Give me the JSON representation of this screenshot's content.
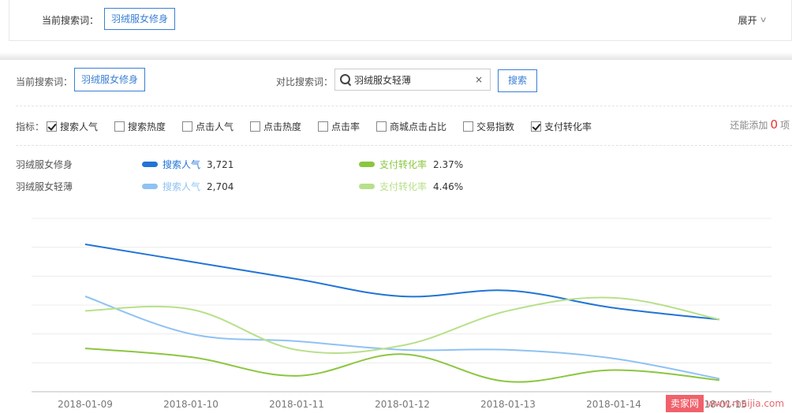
{
  "top": {
    "label": "当前搜索词：",
    "keyword": "羽绒服女修身",
    "expand": "展开"
  },
  "compare": {
    "label": "当前搜索词：",
    "keyword": "羽绒服女修身",
    "compare_label": "对比搜索词：",
    "compare_value": "羽绒服女轻薄",
    "clear": "×",
    "search_btn": "搜索"
  },
  "metrics": {
    "label": "指标：",
    "items": [
      {
        "label": "搜索人气",
        "checked": true
      },
      {
        "label": "搜索热度",
        "checked": false
      },
      {
        "label": "点击人气",
        "checked": false
      },
      {
        "label": "点击热度",
        "checked": false
      },
      {
        "label": "点击率",
        "checked": false
      },
      {
        "label": "商城点击占比",
        "checked": false
      },
      {
        "label": "交易指数",
        "checked": false
      },
      {
        "label": "支付转化率",
        "checked": true
      }
    ],
    "add_prefix": "还能添加",
    "add_count": "0",
    "add_suffix": "项"
  },
  "legend": [
    {
      "keyword": "羽绒服女修身",
      "a": {
        "name": "搜索人气",
        "value": "3,721",
        "color": "#2274d6"
      },
      "b": {
        "name": "支付转化率",
        "value": "2.37%",
        "color": "#8cc63f"
      }
    },
    {
      "keyword": "羽绒服女轻薄",
      "a": {
        "name": "搜索人气",
        "value": "2,704",
        "color": "#8fc2f2"
      },
      "b": {
        "name": "支付转化率",
        "value": "4.46%",
        "color": "#b8e08a"
      }
    }
  ],
  "chart_data": {
    "type": "line",
    "x": [
      "2018-01-09",
      "2018-01-10",
      "2018-01-11",
      "2018-01-12",
      "2018-01-13",
      "2018-01-14",
      "2018-01-15"
    ],
    "ylim": [
      0,
      6
    ],
    "grid": true,
    "series": [
      {
        "name": "搜索人气",
        "color": "#2274d6",
        "values": [
          5.1,
          4.5,
          3.9,
          3.3,
          3.5,
          2.9,
          2.5
        ]
      },
      {
        "name": "支付转化率",
        "color": "#8cc63f",
        "values": [
          1.5,
          1.2,
          0.55,
          1.3,
          0.35,
          0.75,
          0.4
        ]
      },
      {
        "name": "搜索人气",
        "color": "#8fc2f2",
        "values": [
          3.3,
          2.0,
          1.75,
          1.45,
          1.45,
          1.15,
          0.45
        ]
      },
      {
        "name": "支付转化率",
        "color": "#b8e08a",
        "values": [
          2.8,
          2.85,
          1.45,
          1.6,
          2.8,
          3.25,
          2.5
        ]
      }
    ]
  },
  "watermark": {
    "brand": "卖家网",
    "url": "www.maijia.com"
  }
}
